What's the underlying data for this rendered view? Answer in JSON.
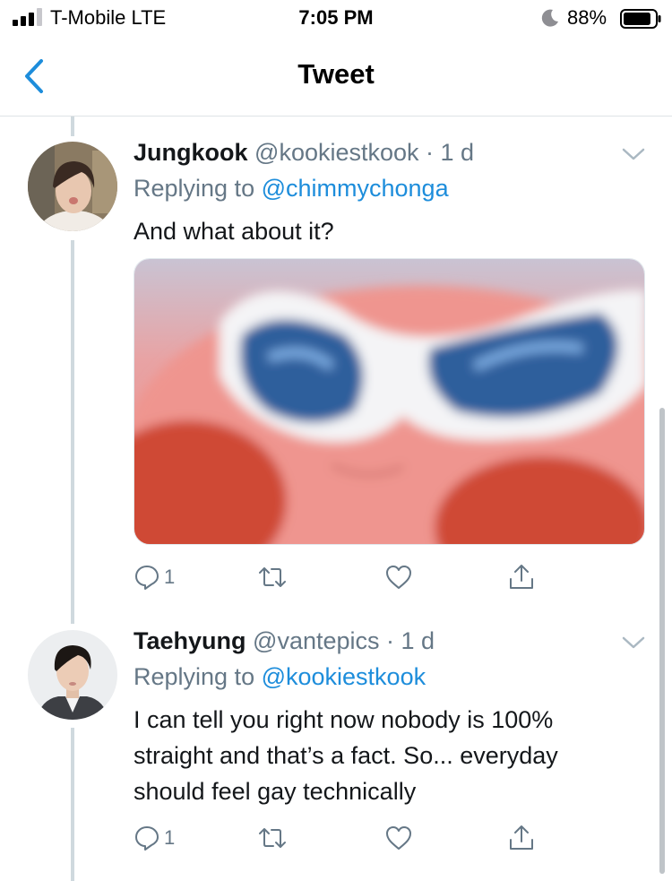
{
  "status_bar": {
    "carrier": "T-Mobile  LTE",
    "time": "7:05 PM",
    "battery": "88%",
    "battery_level": 0.88
  },
  "nav": {
    "title": "Tweet"
  },
  "tweets": [
    {
      "name": "Jungkook",
      "handle_time": "@kookiestkook · 1 d",
      "replying_prefix": "Replying to ",
      "replying_to": "@chimmychonga",
      "text": "And what about it?",
      "reply_count": "1",
      "avatar_icon": "avatar-photo-icon",
      "has_image": true
    },
    {
      "name": "Taehyung",
      "handle_time": "@vantepics · 1 d",
      "replying_prefix": "Replying to ",
      "replying_to": "@kookiestkook",
      "text": "I can tell you right now nobody is 100% straight and that’s a fact. So... everyday should feel gay technically",
      "reply_count": "1",
      "avatar_icon": "avatar-photo-icon",
      "has_image": false
    }
  ],
  "colors": {
    "link": "#1d8ddb",
    "muted": "#657786",
    "thread_line": "#cfd9de",
    "back_chevron": "#1d8ddb"
  },
  "icons": [
    "signal-icon",
    "moon-icon",
    "battery-icon",
    "back-chevron-icon",
    "caret-down-icon",
    "reply-icon",
    "retweet-icon",
    "like-icon",
    "share-icon"
  ]
}
